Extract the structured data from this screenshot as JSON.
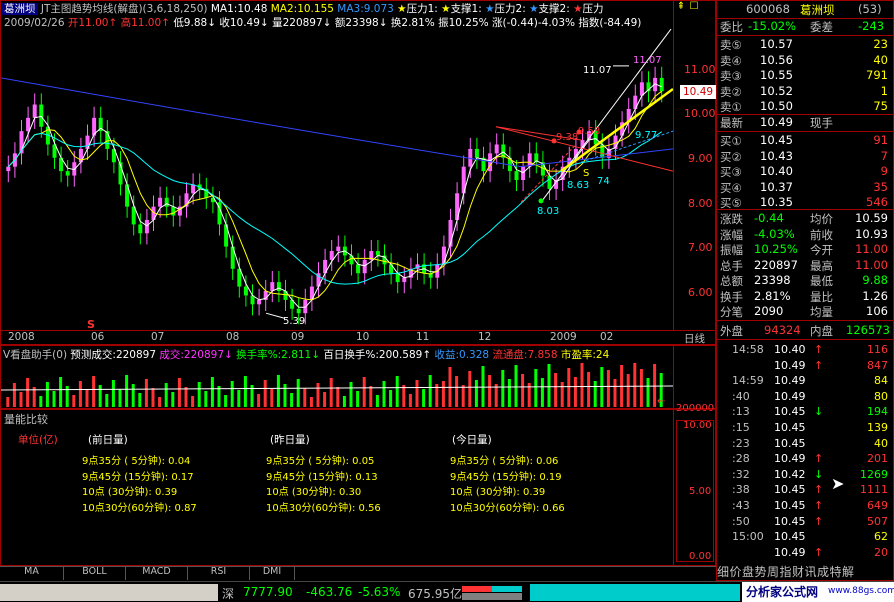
{
  "header": {
    "stock_name": "葛洲坝",
    "indicator_title": "JT主图趋势均线(解盘)",
    "indicator_params": "(3,6,18,250)",
    "ma1": "MA1:10.48",
    "ma2": "MA2:10.155",
    "ma3": "MA3:9.073",
    "pressure1": "压力1:",
    "support1": "支撑1:",
    "pressure2": "压力2:",
    "support2": "支撑2:",
    "pressure3": "压力",
    "date": "2009/02/26",
    "open": "开11.00",
    "high": "高11.00",
    "low": "低9.88",
    "close": "收10.49",
    "volume": "量220897",
    "amount": "额23398",
    "turnover": "换2.81%",
    "amplitude": "振10.25%",
    "change": "涨(-0.44)-4.03%",
    "index": "指数(-84.49)"
  },
  "price_axis": [
    "11.00",
    "10.00",
    "9.00",
    "8.00",
    "7.00",
    "6.00"
  ],
  "current_price_tag": "10.49",
  "chart_annotations": {
    "high_label": "11.07",
    "high_label2": "11.07",
    "low_label": "5.39",
    "low2": "8.03",
    "label_977": "9.77",
    "label_863": "8.63",
    "label_874": "74",
    "label_938": "9.38",
    "label_958": "9.58",
    "signal": "S",
    "signal2": "S"
  },
  "time_axis": [
    "2008",
    "06",
    "07",
    "08",
    "09",
    "10",
    "11",
    "12",
    "2009",
    "02"
  ],
  "time_axis_right": "日线",
  "volume_header": {
    "title": "V看盘助手(0)",
    "pred": "预测成交:220897",
    "deal": "成交:220897",
    "turnover_rate": "换手率%:2.811",
    "hundred_day": "百日换手%:200.589",
    "profit": "收益:0.328",
    "float_cap": "流通盘:7.858",
    "pe": "市盈率:24"
  },
  "volume_axis": [
    "200000"
  ],
  "compare": {
    "title": "量能比较",
    "unit": "单位(亿)",
    "col1": "(前日量)",
    "col2": "(昨日量)",
    "col3": "(今日量)",
    "rows": [
      {
        "a": "9点35分 ( 5分钟): 0.04",
        "b": "9点35分 ( 5分钟): 0.05",
        "c": "9点35分 ( 5分钟): 0.06"
      },
      {
        "a": "9点45分 (15分钟): 0.17",
        "b": "9点45分 (15分钟): 0.13",
        "c": "9点45分 (15分钟): 0.19"
      },
      {
        "a": "10点   (30分钟): 0.39",
        "b": "10点   (30分钟): 0.30",
        "c": "10点   (30分钟): 0.39"
      },
      {
        "a": "10点30分(60分钟): 0.87",
        "b": "10点30分(60分钟): 0.56",
        "c": "10点30分(60分钟): 0.66"
      }
    ],
    "axis": [
      "10.00",
      "5.00",
      "0.00"
    ]
  },
  "tabs": [
    "MA",
    "BOLL",
    "MACD",
    "RSI",
    "DMI"
  ],
  "status_bar": {
    "market": "深",
    "index_val": "7777.90",
    "change": "-463.76",
    "pct": "-5.63%",
    "amount": "675.95亿",
    "site": "分析家公式网",
    "url": "www.88gs.com"
  },
  "quote": {
    "code": "600068",
    "name": "葛洲坝",
    "num": "(53)",
    "wei_bi_label": "委比",
    "wei_bi": "-15.02%",
    "wei_cha_label": "委差",
    "wei_cha": "-243",
    "asks": [
      {
        "label": "卖⑤",
        "price": "10.57",
        "vol": "23"
      },
      {
        "label": "卖④",
        "price": "10.56",
        "vol": "40"
      },
      {
        "label": "卖③",
        "price": "10.55",
        "vol": "791"
      },
      {
        "label": "卖②",
        "price": "10.52",
        "vol": "1"
      },
      {
        "label": "卖①",
        "price": "10.50",
        "vol": "75"
      }
    ],
    "latest_label": "最新",
    "latest": "10.49",
    "current_hand_label": "现手",
    "bids": [
      {
        "label": "买①",
        "price": "10.45",
        "vol": "91"
      },
      {
        "label": "买②",
        "price": "10.43",
        "vol": "7"
      },
      {
        "label": "买③",
        "price": "10.40",
        "vol": "9"
      },
      {
        "label": "买④",
        "price": "10.37",
        "vol": "35"
      },
      {
        "label": "买⑤",
        "price": "10.35",
        "vol": "546"
      }
    ],
    "stats": [
      {
        "l1": "涨跌",
        "v1": "-0.44",
        "l2": "均价",
        "v2": "10.59"
      },
      {
        "l1": "涨幅",
        "v1": "-4.03%",
        "l2": "前收",
        "v2": "10.93"
      },
      {
        "l1": "振幅",
        "v1": "10.25%",
        "l2": "今开",
        "v2": "11.00"
      },
      {
        "l1": "总手",
        "v1": "220897",
        "l2": "最高",
        "v2": "11.00"
      },
      {
        "l1": "总额",
        "v1": "23398",
        "l2": "最低",
        "v2": "9.88"
      },
      {
        "l1": "换手",
        "v1": "2.81%",
        "l2": "量比",
        "v2": "1.26"
      },
      {
        "l1": "分笔",
        "v1": "2090",
        "l2": "均量",
        "v2": "106"
      }
    ],
    "outer_label": "外盘",
    "outer": "94324",
    "inner_label": "内盘",
    "inner": "126573"
  },
  "ticks": [
    {
      "t": "14:58",
      "p": "10.40",
      "d": "↑",
      "v": "116"
    },
    {
      "t": "",
      "p": "10.49",
      "d": "↑",
      "v": "847"
    },
    {
      "t": "14:59",
      "p": "10.49",
      "d": "",
      "v": "84"
    },
    {
      "t": ":40",
      "p": "10.49",
      "d": "",
      "v": "80"
    },
    {
      "t": ":13",
      "p": "10.45",
      "d": "↓",
      "v": "194"
    },
    {
      "t": ":15",
      "p": "10.45",
      "d": "",
      "v": "139"
    },
    {
      "t": ":23",
      "p": "10.45",
      "d": "",
      "v": "40"
    },
    {
      "t": ":28",
      "p": "10.49",
      "d": "↑",
      "v": "201"
    },
    {
      "t": ":32",
      "p": "10.42",
      "d": "↓",
      "v": "1269"
    },
    {
      "t": ":38",
      "p": "10.45",
      "d": "↑",
      "v": "1111"
    },
    {
      "t": ":43",
      "p": "10.45",
      "d": "↑",
      "v": "649"
    },
    {
      "t": ":50",
      "p": "10.45",
      "d": "↑",
      "v": "507"
    },
    {
      "t": "15:00",
      "p": "10.45",
      "d": "",
      "v": "62"
    },
    {
      "t": "",
      "p": "10.49",
      "d": "↑",
      "v": "20"
    }
  ],
  "right_tabs": "细价盘势周指财讯成特解"
}
